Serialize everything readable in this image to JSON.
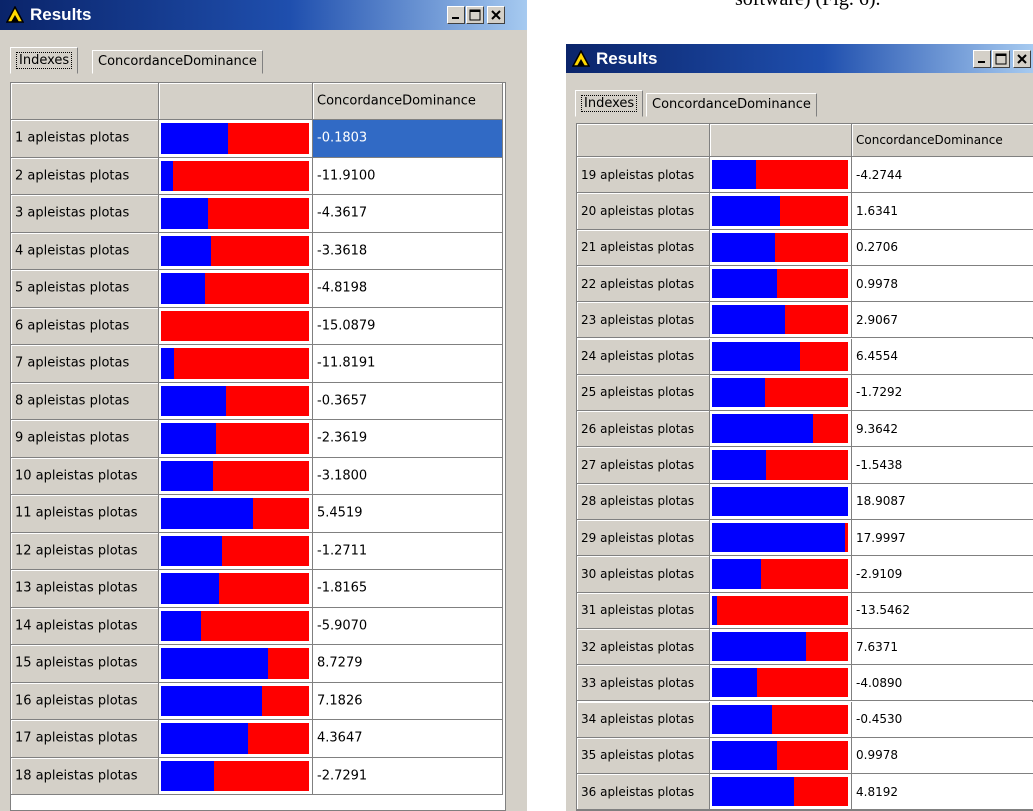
{
  "background_text": "software) (Fig. 6).",
  "colors": {
    "title_bar": "#0a246a",
    "bar_concordance": "#0000ff",
    "bar_remaining": "#ff0000",
    "selection": "#316ac5",
    "window_face": "#d4d0c8"
  },
  "icons": {
    "app": "yellow-triangle-icon",
    "minimize": "minimize-icon",
    "maximize": "maximize-icon",
    "close": "close-icon"
  },
  "windows": [
    {
      "title": "Results",
      "tabs": [
        {
          "label": "Indexes",
          "active": true
        },
        {
          "label": "ConcordanceDominance",
          "active": false
        }
      ],
      "columns": [
        "",
        "",
        "ConcordanceDominance"
      ],
      "selected_row": 0,
      "rows": [
        {
          "label": "1 apleistas plotas",
          "value": "-0.1803",
          "bar_fraction": 0.45
        },
        {
          "label": "2 apleistas plotas",
          "value": "-11.9100",
          "bar_fraction": 0.08
        },
        {
          "label": "3 apleistas plotas",
          "value": "-4.3617",
          "bar_fraction": 0.32
        },
        {
          "label": "4 apleistas plotas",
          "value": "-3.3618",
          "bar_fraction": 0.34
        },
        {
          "label": "5 apleistas plotas",
          "value": "-4.8198",
          "bar_fraction": 0.3
        },
        {
          "label": "6 apleistas plotas",
          "value": "-15.0879",
          "bar_fraction": 0.0
        },
        {
          "label": "7 apleistas plotas",
          "value": "-11.8191",
          "bar_fraction": 0.09
        },
        {
          "label": "8 apleistas plotas",
          "value": "-0.3657",
          "bar_fraction": 0.44
        },
        {
          "label": "9 apleistas plotas",
          "value": "-2.3619",
          "bar_fraction": 0.37
        },
        {
          "label": "10 apleistas plotas",
          "value": "-3.1800",
          "bar_fraction": 0.35
        },
        {
          "label": "11 apleistas plotas",
          "value": "5.4519",
          "bar_fraction": 0.62
        },
        {
          "label": "12 apleistas plotas",
          "value": "-1.2711",
          "bar_fraction": 0.41
        },
        {
          "label": "13 apleistas plotas",
          "value": "-1.8165",
          "bar_fraction": 0.39
        },
        {
          "label": "14 apleistas plotas",
          "value": "-5.9070",
          "bar_fraction": 0.27
        },
        {
          "label": "15 apleistas plotas",
          "value": "8.7279",
          "bar_fraction": 0.72
        },
        {
          "label": "16 apleistas plotas",
          "value": "7.1826",
          "bar_fraction": 0.68
        },
        {
          "label": "17 apleistas plotas",
          "value": "4.3647",
          "bar_fraction": 0.59
        },
        {
          "label": "18 apleistas plotas",
          "value": "-2.7291",
          "bar_fraction": 0.36
        }
      ]
    },
    {
      "title": "Results",
      "tabs": [
        {
          "label": "Indexes",
          "active": true
        },
        {
          "label": "ConcordanceDominance",
          "active": false
        }
      ],
      "columns": [
        "",
        "",
        "ConcordanceDominance"
      ],
      "selected_row": -1,
      "rows": [
        {
          "label": "19 apleistas plotas",
          "value": "-4.2744",
          "bar_fraction": 0.32
        },
        {
          "label": "20 apleistas plotas",
          "value": "1.6341",
          "bar_fraction": 0.5
        },
        {
          "label": "21 apleistas plotas",
          "value": "0.2706",
          "bar_fraction": 0.46
        },
        {
          "label": "22 apleistas plotas",
          "value": "0.9978",
          "bar_fraction": 0.48
        },
        {
          "label": "23 apleistas plotas",
          "value": "2.9067",
          "bar_fraction": 0.54
        },
        {
          "label": "24 apleistas plotas",
          "value": "6.4554",
          "bar_fraction": 0.65
        },
        {
          "label": "25 apleistas plotas",
          "value": "-1.7292",
          "bar_fraction": 0.39
        },
        {
          "label": "26 apleistas plotas",
          "value": "9.3642",
          "bar_fraction": 0.74
        },
        {
          "label": "27 apleistas plotas",
          "value": "-1.5438",
          "bar_fraction": 0.4
        },
        {
          "label": "28 apleistas plotas",
          "value": "18.9087",
          "bar_fraction": 1.0
        },
        {
          "label": "29 apleistas plotas",
          "value": "17.9997",
          "bar_fraction": 0.98
        },
        {
          "label": "30 apleistas plotas",
          "value": "-2.9109",
          "bar_fraction": 0.36
        },
        {
          "label": "31 apleistas plotas",
          "value": "-13.5462",
          "bar_fraction": 0.04
        },
        {
          "label": "32 apleistas plotas",
          "value": "7.6371",
          "bar_fraction": 0.69
        },
        {
          "label": "33 apleistas plotas",
          "value": "-4.0890",
          "bar_fraction": 0.33
        },
        {
          "label": "34 apleistas plotas",
          "value": "-0.4530",
          "bar_fraction": 0.44
        },
        {
          "label": "35 apleistas plotas",
          "value": "0.9978",
          "bar_fraction": 0.48
        },
        {
          "label": "36 apleistas plotas",
          "value": "4.8192",
          "bar_fraction": 0.6
        }
      ]
    }
  ]
}
